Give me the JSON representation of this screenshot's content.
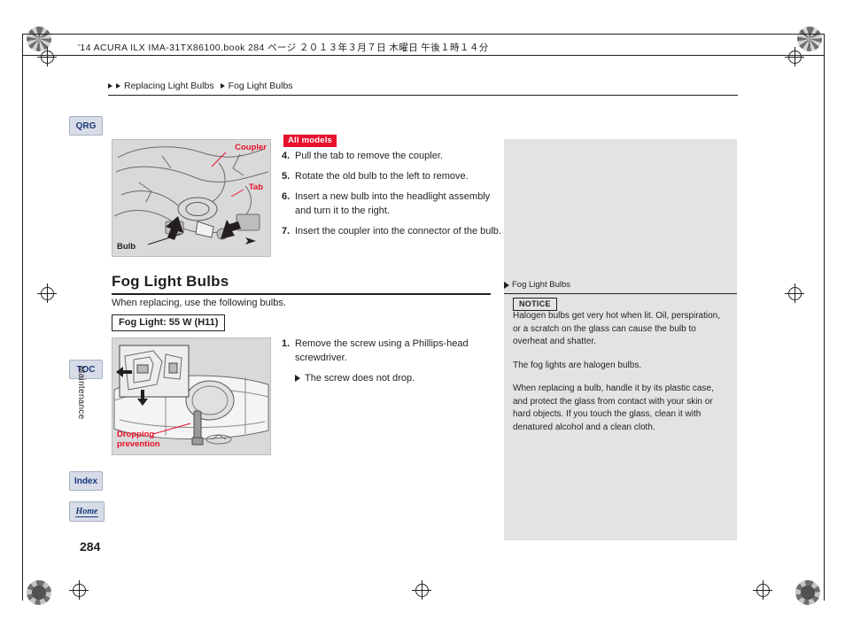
{
  "header": {
    "file_line": "'14 ACURA  ILX IMA-31TX86100.book   284 ページ   ２０１３年３月７日   木曜日   午後１時１４分",
    "breadcrumb_1": "Replacing Light Bulbs",
    "breadcrumb_2": "Fog Light Bulbs"
  },
  "sidebar": {
    "qrg": "QRG",
    "toc": "TOC",
    "index": "Index",
    "home": "Home",
    "section_label": "Maintenance"
  },
  "page_number": "284",
  "top_illustration": {
    "label_coupler": "Coupler",
    "label_tab": "Tab",
    "label_bulb": "Bulb"
  },
  "bottom_illustration": {
    "label_dropping_prevention_line1": "Dropping",
    "label_dropping_prevention_line2": "prevention"
  },
  "all_models_badge": "All models",
  "steps_top": [
    {
      "num": "4.",
      "text": "Pull the tab to remove the coupler."
    },
    {
      "num": "5.",
      "text": "Rotate the old bulb to the left to remove."
    },
    {
      "num": "6.",
      "text": "Insert a new bulb into the headlight assembly and turn it to the right."
    },
    {
      "num": "7.",
      "text": "Insert the coupler into the connector of the bulb."
    }
  ],
  "section": {
    "title": "Fog Light Bulbs",
    "lead": "When replacing, use the following bulbs.",
    "spec_box": "Fog Light: 55 W (H11)"
  },
  "steps_bottom": [
    {
      "num": "1.",
      "text": "Remove the screw using a Phillips-head screwdriver.",
      "sub": "The screw does not drop."
    }
  ],
  "side_panel": {
    "title": "Fog Light Bulbs",
    "notice_label": "NOTICE",
    "paragraphs": [
      "Halogen bulbs get very hot when lit. Oil, perspiration, or a scratch on the glass can cause the bulb to overheat and shatter.",
      "The fog lights are halogen bulbs.",
      "When replacing a bulb, handle it by its plastic case, and protect the glass from contact with your skin or hard objects. If you touch the glass, clean it with denatured alcohol and a clean cloth."
    ]
  },
  "colors": {
    "accent_red": "#e8112d",
    "tab_blue": "#1b3a7a",
    "panel_gray": "#e3e3e3"
  }
}
